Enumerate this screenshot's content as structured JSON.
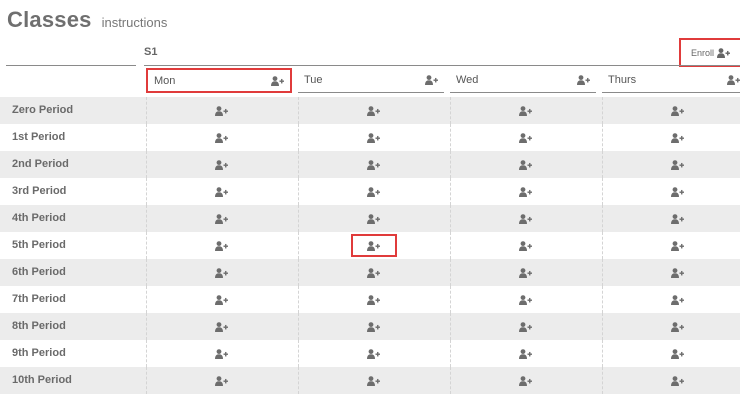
{
  "header": {
    "title": "Classes",
    "link": "instructions"
  },
  "term": {
    "label": "S1",
    "enroll_label": "Enroll"
  },
  "days": [
    {
      "label": "Mon",
      "highlighted": true
    },
    {
      "label": "Tue",
      "highlighted": false
    },
    {
      "label": "Wed",
      "highlighted": false
    },
    {
      "label": "Thurs",
      "highlighted": false
    }
  ],
  "periods": [
    "Zero Period",
    "1st Period",
    "2nd Period",
    "3rd Period",
    "4th Period",
    "5th Period",
    "6th Period",
    "7th Period",
    "8th Period",
    "9th Period",
    "10th Period"
  ],
  "highlighted_slot": {
    "period": "5th Period",
    "day": "Tue"
  },
  "icons": {
    "enroll": "add-user-icon"
  },
  "colors": {
    "highlight": "#e03b3b",
    "row_alt": "#ececec",
    "icon": "#6d6d6d"
  }
}
